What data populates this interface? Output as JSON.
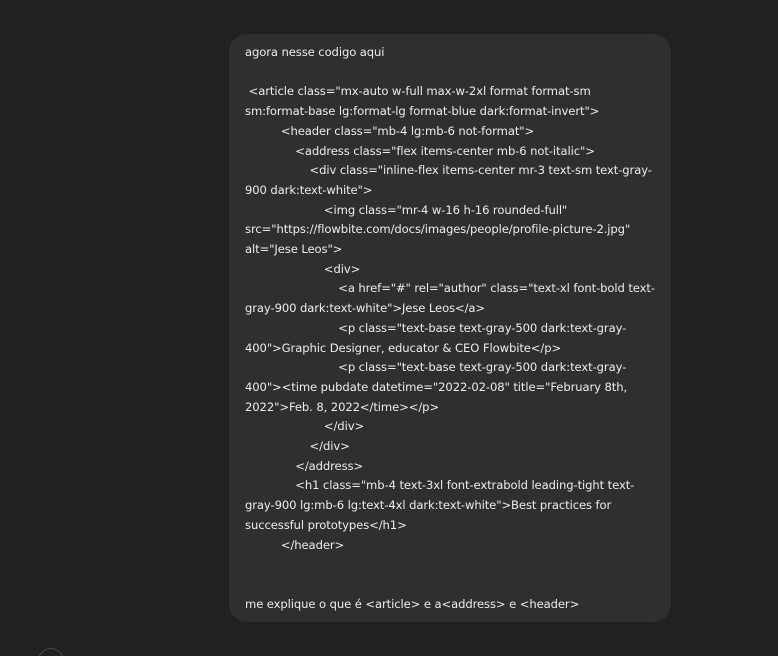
{
  "conversation": {
    "user_message": "agora nesse codigo aqui\n\n <article class=\"mx-auto w-full max-w-2xl format format-sm sm:format-base lg:format-lg format-blue dark:format-invert\">\n          <header class=\"mb-4 lg:mb-6 not-format\">\n              <address class=\"flex items-center mb-6 not-italic\">\n                  <div class=\"inline-flex items-center mr-3 text-sm text-gray-900 dark:text-white\">\n                      <img class=\"mr-4 w-16 h-16 rounded-full\" src=\"https://flowbite.com/docs/images/people/profile-picture-2.jpg\" alt=\"Jese Leos\">\n                      <div>\n                          <a href=\"#\" rel=\"author\" class=\"text-xl font-bold text-gray-900 dark:text-white\">Jese Leos</a>\n                          <p class=\"text-base text-gray-500 dark:text-gray-400\">Graphic Designer, educator & CEO Flowbite</p>\n                          <p class=\"text-base text-gray-500 dark:text-gray-400\"><time pubdate datetime=\"2022-02-08\" title=\"February 8th, 2022\">Feb. 8, 2022</time></p>\n                      </div>\n                  </div>\n              </address>\n              <h1 class=\"mb-4 text-3xl font-extrabold leading-tight text-gray-900 lg:mb-6 lg:text-4xl dark:text-white\">Best practices for successful prototypes</h1>\n          </header>\n\n\nme explique o que é <article> e a<address> e <header>"
  },
  "colors": {
    "background": "#212121",
    "bubble": "#2f2f2f",
    "text": "#ececec"
  }
}
